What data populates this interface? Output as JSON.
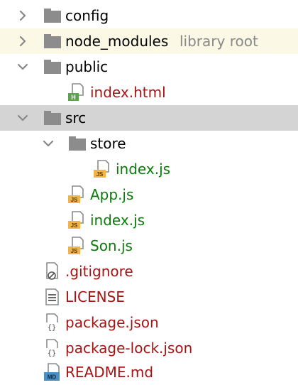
{
  "colors": {
    "excluded_row": "#fbf9e5",
    "selected_row": "#d4d4d4",
    "folder": "#8c8c8c",
    "modified_red": "#a31515",
    "added_green": "#0b7a0b",
    "hint_gray": "#888888"
  },
  "tree": [
    {
      "label": "config",
      "icon": "folder-icon",
      "expander": "chevron-right-icon",
      "color": "default"
    },
    {
      "label": "node_modules",
      "hint": "library root",
      "icon": "folder-icon",
      "expander": "chevron-right-icon",
      "color": "default",
      "state": "excluded"
    },
    {
      "label": "public",
      "icon": "folder-icon",
      "expander": "chevron-down-icon",
      "color": "default"
    },
    {
      "label": "index.html",
      "icon": "html-file-icon",
      "color": "red"
    },
    {
      "label": "src",
      "icon": "folder-icon",
      "expander": "chevron-down-icon",
      "color": "default",
      "state": "selected"
    },
    {
      "label": "store",
      "icon": "folder-icon",
      "expander": "chevron-down-icon",
      "color": "default"
    },
    {
      "label": "index.js",
      "icon": "js-file-icon",
      "color": "green"
    },
    {
      "label": "App.js",
      "icon": "js-file-icon",
      "color": "green"
    },
    {
      "label": "index.js",
      "icon": "js-file-icon",
      "color": "green"
    },
    {
      "label": "Son.js",
      "icon": "js-file-icon",
      "color": "green"
    },
    {
      "label": ".gitignore",
      "icon": "gitignore-file-icon",
      "color": "red"
    },
    {
      "label": "LICENSE",
      "icon": "text-file-icon",
      "color": "red"
    },
    {
      "label": "package.json",
      "icon": "json-file-icon",
      "color": "red"
    },
    {
      "label": "package-lock.json",
      "icon": "json-file-icon",
      "color": "red"
    },
    {
      "label": "README.md",
      "icon": "markdown-file-icon",
      "color": "red"
    }
  ]
}
